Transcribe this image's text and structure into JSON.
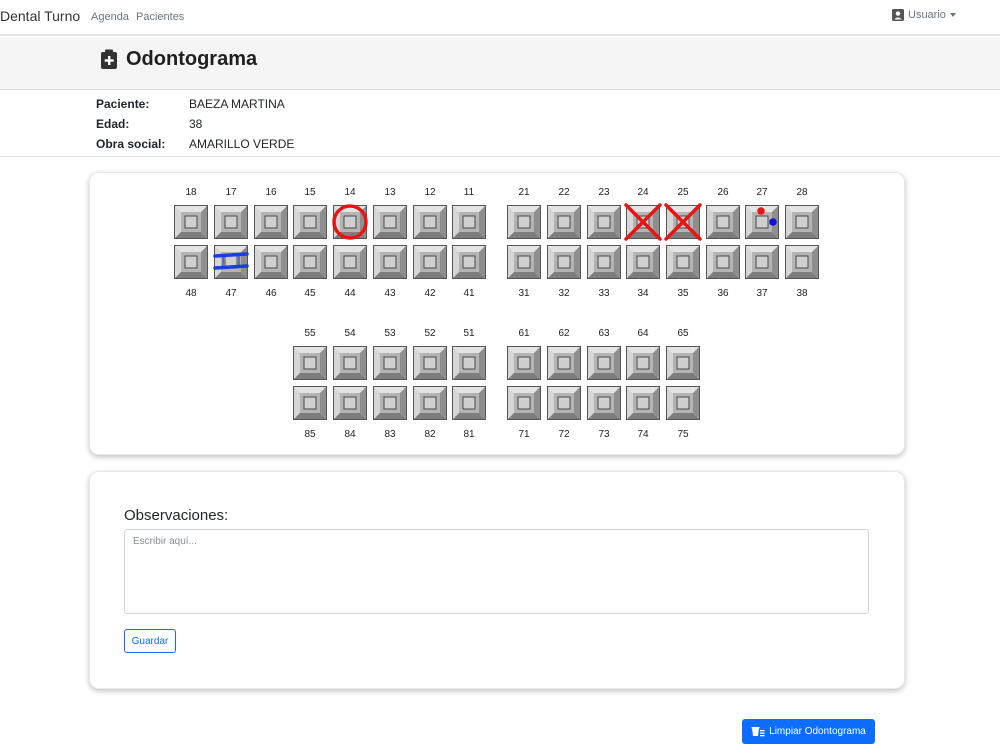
{
  "navbar": {
    "brand": "Dental Turno",
    "links": [
      "Agenda",
      "Pacientes"
    ],
    "user_label": "Usuario",
    "user_icon": "user-icon"
  },
  "header": {
    "title": "Odontograma",
    "icon": "medical-case-icon"
  },
  "patient": {
    "name_label": "Paciente:",
    "name": "BAEZA MARTINA",
    "age_label": "Edad:",
    "age": "38",
    "insurance_label": "Obra social:",
    "insurance": "AMARILLO VERDE"
  },
  "odontogram": {
    "permanent_upper": [
      "18",
      "17",
      "16",
      "15",
      "14",
      "13",
      "12",
      "11",
      "21",
      "22",
      "23",
      "24",
      "25",
      "26",
      "27",
      "28"
    ],
    "permanent_lower": [
      "48",
      "47",
      "46",
      "45",
      "44",
      "43",
      "42",
      "41",
      "31",
      "32",
      "33",
      "34",
      "35",
      "36",
      "37",
      "38"
    ],
    "primary_upper": [
      "55",
      "54",
      "53",
      "52",
      "51",
      "61",
      "62",
      "63",
      "64",
      "65"
    ],
    "primary_lower": [
      "85",
      "84",
      "83",
      "82",
      "81",
      "71",
      "72",
      "73",
      "74",
      "75"
    ],
    "marks": [
      {
        "tooth": "14",
        "type": "circle",
        "color": "#e81414"
      },
      {
        "tooth": "24",
        "type": "cross",
        "color": "#e81414"
      },
      {
        "tooth": "25",
        "type": "cross",
        "color": "#e81414"
      },
      {
        "tooth": "47",
        "type": "bridge-lines",
        "color": "#1a3fe0"
      },
      {
        "tooth": "27",
        "type": "dot-top",
        "color": "#e81414"
      },
      {
        "tooth": "27",
        "type": "dot-right",
        "color": "#1212d6"
      }
    ]
  },
  "observations": {
    "title": "Observaciones:",
    "placeholder": "Escribir aquí...",
    "save_label": "Guardar"
  },
  "actions": {
    "clear_label": "Limpiar Odontograma",
    "clear_icon": "eraser-icon"
  }
}
